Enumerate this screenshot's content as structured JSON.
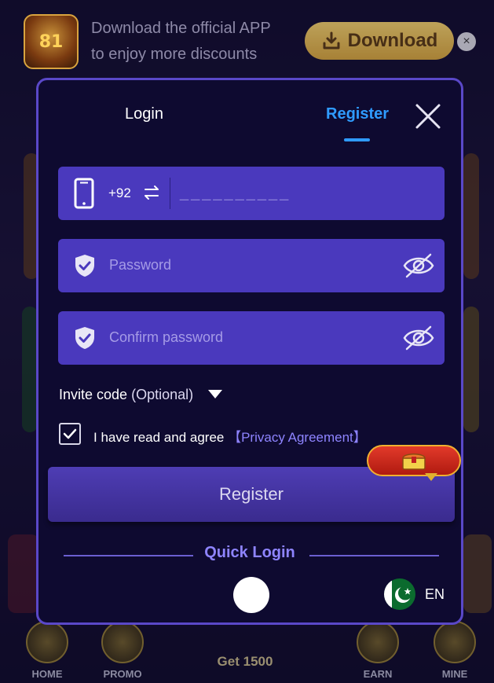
{
  "banner": {
    "app_icon_text": "81",
    "line1": "Download the official APP",
    "line2": "to enjoy more discounts",
    "download_label": "Download",
    "close_symbol": "×"
  },
  "modal": {
    "tabs": {
      "login": "Login",
      "register": "Register",
      "active": "register"
    },
    "phone": {
      "prefix": "+92",
      "placeholder": "__________"
    },
    "password": {
      "placeholder": "Password"
    },
    "confirm_password": {
      "placeholder": "Confirm password"
    },
    "invite": {
      "label": "Invite code",
      "optional": "(Optional)"
    },
    "agree": {
      "text": "I have read and agree",
      "link": "【Privacy Agreement】",
      "checked": true
    },
    "register_button": "Register",
    "quick_login": "Quick Login",
    "language": {
      "code": "EN"
    }
  },
  "tabbar": {
    "items": [
      {
        "label": "HOME"
      },
      {
        "label": "PROMO"
      },
      {
        "label": "EARN"
      },
      {
        "label": "MINE"
      }
    ],
    "center": "Get 1500"
  },
  "colors": {
    "modal_bg": "#0e0a30",
    "field_bg": "#4a39bd",
    "accent_blue": "#2f9bff",
    "link_purple": "#8e84ff",
    "modal_border": "#5a48c8"
  },
  "icons": [
    "phone-icon",
    "swap-icon",
    "shield-check-icon",
    "eye-off-icon",
    "close-icon",
    "caret-down-icon",
    "check-icon",
    "download-icon",
    "gift-chest-icon",
    "pakistan-flag-icon"
  ]
}
